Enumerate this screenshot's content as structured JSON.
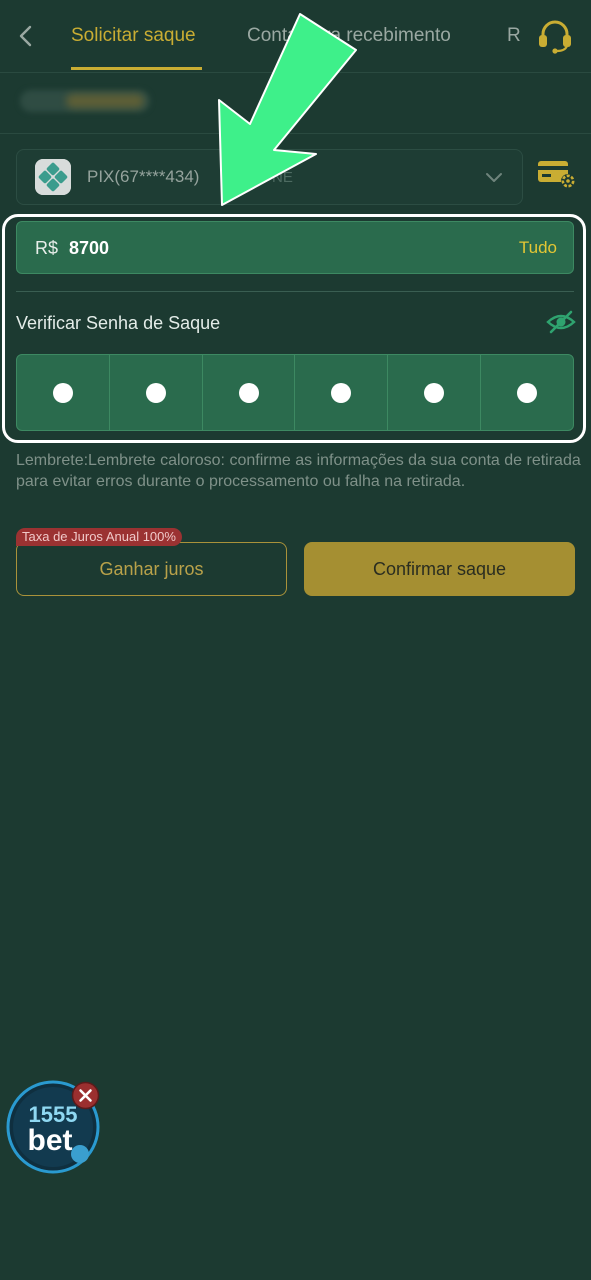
{
  "header": {
    "tabs": [
      {
        "label": "Solicitar saque",
        "active": true
      },
      {
        "label": "Conta para recebimento",
        "active": false
      },
      {
        "label": "R",
        "active": false
      }
    ]
  },
  "account": {
    "label": "PIX(67****434)",
    "suffix": "NE"
  },
  "amount": {
    "currency": "R$",
    "value": "8700",
    "all_label": "Tudo"
  },
  "password": {
    "label": "Verificar Senha de Saque",
    "digits_entered": 6
  },
  "reminder": "Lembrete:Lembrete caloroso: confirme as informações da sua conta de retirada para evitar erros durante o processamento ou falha na retirada.",
  "actions": {
    "rate_badge": "Taxa de Juros Anual 100%",
    "earn_label": "Ganhar juros",
    "confirm_label": "Confirmar saque"
  },
  "floating": {
    "brand_number": "1555",
    "brand_word": "bet"
  },
  "colors": {
    "background": "#1c3a31",
    "accent": "#c9ad33",
    "field": "#2a6b4d",
    "arrow": "#3ef08a"
  }
}
